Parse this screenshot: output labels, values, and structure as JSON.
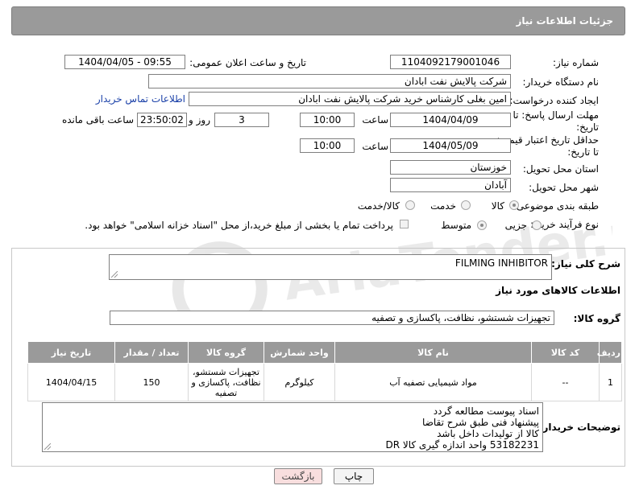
{
  "header": {
    "title": "جزئیات اطلاعات نیاز"
  },
  "form": {
    "need_number_label": "شماره نیاز:",
    "need_number": "1104092179001046",
    "announce_datetime_label": "تاریخ و ساعت اعلان عمومی:",
    "announce_datetime": "1404/04/05 - 09:55",
    "buyer_org_label": "نام دستگاه خریدار:",
    "buyer_org": "شرکت پالایش نفت ابادان",
    "requester_label": "ایجاد کننده درخواست:",
    "requester": "امین بغلی کارشناس خرید شرکت پالایش نفت ابادان",
    "buyer_contact_link": "اطلاعات تماس خریدار",
    "reply_deadline_label_1": "مهلت ارسال پاسخ: تا",
    "reply_deadline_label_2": "تاریخ:",
    "reply_date": "1404/04/09",
    "time_label": "ساعت",
    "reply_time": "10:00",
    "days_value": "3",
    "days_label": "روز و",
    "remaining_time": "23:50:02",
    "remaining_label": "ساعت باقی مانده",
    "price_validity_label_1": "حداقل تاریخ اعتبار قیمت:",
    "price_validity_label_2": "تا تاریخ:",
    "price_date": "1404/05/09",
    "price_time": "10:00",
    "province_label": "استان محل تحویل:",
    "province": "خوزستان",
    "city_label": "شهر محل تحویل:",
    "city": "آبادان",
    "category_label": "طبقه بندی موضوعی:",
    "category_options": [
      "کالا",
      "خدمت",
      "کالا/خدمت"
    ],
    "purchase_type_label": "نوع فرآیند خرید :",
    "purchase_type_options": [
      "جزیی",
      "متوسط"
    ],
    "payment_note": "پرداخت تمام یا بخشی از مبلغ خرید،از محل \"اسناد خزانه اسلامی\" خواهد بود."
  },
  "details": {
    "general_desc_label": "شرح کلی نیاز:",
    "general_desc": "FILMING INHIBITOR",
    "goods_info_title": "اطلاعات کالاهای مورد نیاز",
    "goods_group_label": "گروه کالا:",
    "goods_group": "تجهیزات شستشو، نظافت، پاکسازی و تصفیه",
    "table": {
      "headers": [
        "ردیف",
        "کد کالا",
        "نام کالا",
        "واحد شمارش",
        "گروه کالا",
        "تعداد / مقدار",
        "تاریخ نیاز"
      ],
      "rows": [
        [
          "1",
          "--",
          "مواد شیمیایی تصفیه آب",
          "کیلوگرم",
          "تجهیزات شستشو، نظافت، پاکسازی و تصفیه",
          "150",
          "1404/04/15"
        ]
      ]
    },
    "buyer_notes_label": "توضیحات خریدار:",
    "buyer_notes": [
      "اسناد پیوست مطالعه گردد",
      "پیشنهاد فنی طبق شرح تقاضا",
      "کالا از تولیدات داخل باشد",
      "53182231 واحد اندازه گیری کالا DR"
    ]
  },
  "buttons": {
    "print": "چاپ",
    "back": "بازگشت"
  },
  "watermark": {
    "text": "AriaTender.net"
  },
  "colors": {
    "header_bg": "#9a9a9a",
    "link": "#1a40a8",
    "back_btn_bg": "#f8dede",
    "watermark": "#d0d0d0"
  }
}
